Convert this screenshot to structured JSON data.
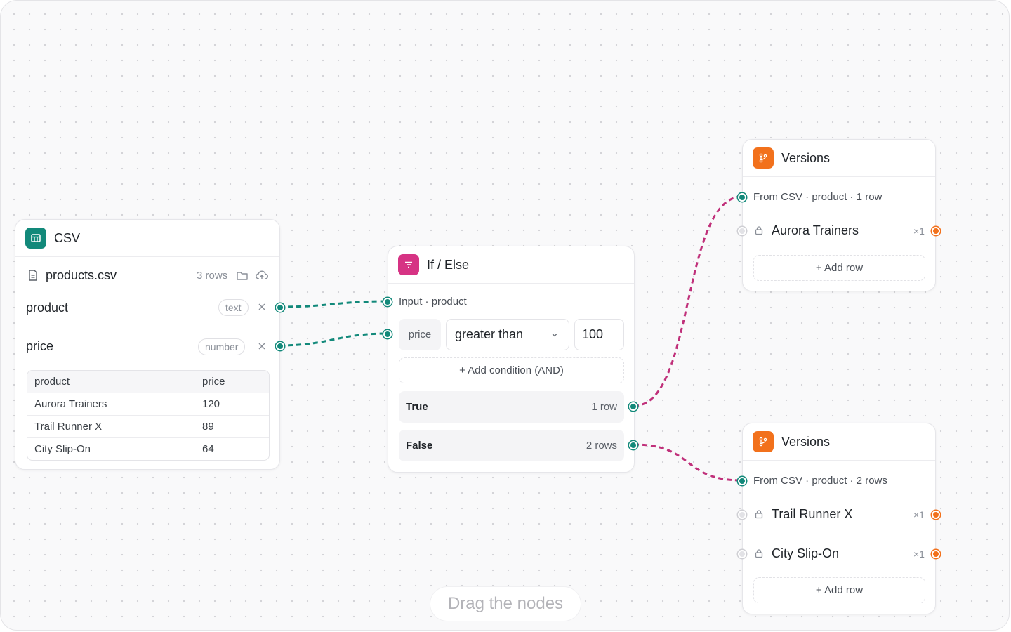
{
  "hint": "Drag the nodes",
  "csv": {
    "title": "CSV",
    "file_name": "products.csv",
    "rows_count": "3 rows",
    "columns": [
      {
        "name": "product",
        "type": "text"
      },
      {
        "name": "price",
        "type": "number"
      }
    ],
    "table": {
      "headers": [
        "product",
        "price"
      ],
      "rows": [
        [
          "Aurora Trainers",
          "120"
        ],
        [
          "Trail Runner X",
          "89"
        ],
        [
          "City Slip-On",
          "64"
        ]
      ]
    },
    "icons": [
      "table-icon",
      "file-icon",
      "folder-icon",
      "upload-cloud-icon",
      "close-icon"
    ]
  },
  "ifelse": {
    "title": "If / Else",
    "input_label": "Input · product",
    "condition": {
      "field": "price",
      "operator": "greater than",
      "value": "100"
    },
    "add_condition": "+ Add condition (AND)",
    "true_label": "True",
    "true_count": "1 row",
    "false_label": "False",
    "false_count": "2 rows"
  },
  "versions_top": {
    "title": "Versions",
    "source": "From CSV · product · 1 row",
    "items": [
      {
        "label": "Aurora Trainers",
        "mult": "×1"
      }
    ],
    "add_row": "+ Add row"
  },
  "versions_bottom": {
    "title": "Versions",
    "source": "From CSV · product · 2 rows",
    "items": [
      {
        "label": "Trail Runner X",
        "mult": "×1"
      },
      {
        "label": "City Slip-On",
        "mult": "×1"
      }
    ],
    "add_row": "+ Add row"
  },
  "colors": {
    "teal": "#12897a",
    "pink": "#d63384",
    "orange": "#f2711c",
    "wire_teal": "#12897a",
    "wire_pink": "#c0307a"
  }
}
